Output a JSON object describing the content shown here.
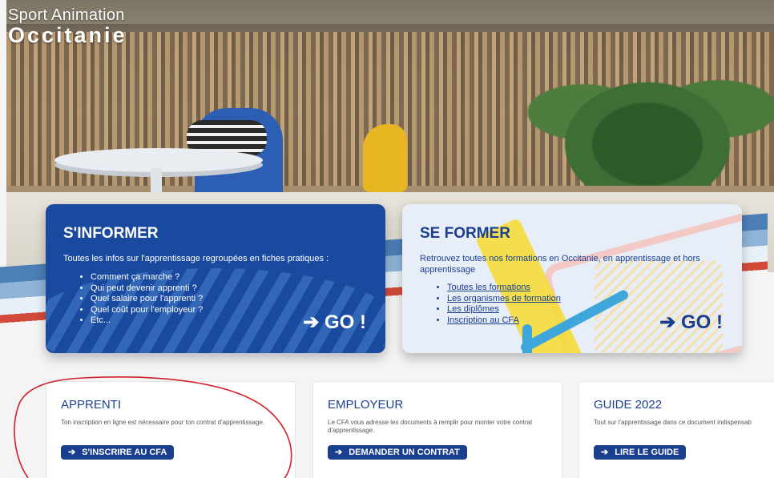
{
  "brand": {
    "line1": "Sport Animation",
    "line2": "Occitanie"
  },
  "informer": {
    "title": "S'INFORMER",
    "intro": "Toutes les infos sur l'apprentissage regroupées en fiches pratiques :",
    "items": [
      "Comment ça marche ?",
      "Qui peut devenir apprenti ?",
      "Quel salaire pour l'apprenti ?",
      "Quel coût pour l'employeur ?",
      "Etc..."
    ],
    "go": "➔ GO !"
  },
  "former": {
    "title": "SE FORMER",
    "intro": "Retrouvez toutes nos formations en Occitanie, en apprentissage et hors apprentissage",
    "links": [
      "Toutes les formations",
      "Les organismes de formation",
      "Les diplômes",
      "Inscription au CFA"
    ],
    "go": "➔ GO !"
  },
  "cards": [
    {
      "title": "APPRENTI",
      "text": "Ton inscription en ligne est nécessaire pour ton contrat d'apprentissage.",
      "button": "S'INSCRIRE AU CFA"
    },
    {
      "title": "EMPLOYEUR",
      "text": "Le CFA vous adresse les documents à remplir pour monter votre contrat d'apprentissage.",
      "button": "DEMANDER UN CONTRAT"
    },
    {
      "title": "GUIDE 2022",
      "text": "Tout sur l'apprentissage dans ce document indispensab",
      "button": "LIRE LE GUIDE"
    }
  ],
  "colors": {
    "primary": "#1a4aa0",
    "annotation": "#d0202a",
    "card_light": "#e8eef8"
  }
}
